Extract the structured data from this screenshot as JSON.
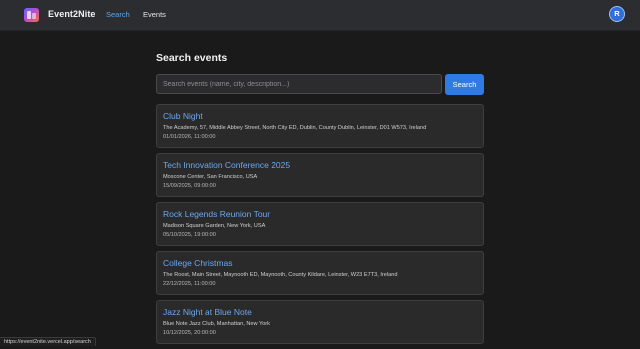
{
  "nav": {
    "brand": "Event2Nite",
    "links": [
      {
        "label": "Search",
        "active": true
      },
      {
        "label": "Events",
        "active": false
      }
    ],
    "avatar_initial": "R",
    "logo_icon": "app-logo-icon"
  },
  "main": {
    "title": "Search events",
    "search": {
      "placeholder": "Search events (name, city, description...)",
      "value": "",
      "button_label": "Search"
    },
    "events": [
      {
        "title": "Club Night",
        "location": "The Academy, 57, Middle Abbey Street, North City ED, Dublin, County Dublin, Leinster, D01 W573, Ireland",
        "datetime": "01/01/2026, 11:00:00"
      },
      {
        "title": "Tech Innovation Conference 2025",
        "location": "Moscone Center, San Francisco, USA",
        "datetime": "15/09/2025, 09:00:00"
      },
      {
        "title": "Rock Legends Reunion Tour",
        "location": "Madison Square Garden, New York, USA",
        "datetime": "05/10/2025, 19:00:00"
      },
      {
        "title": "College Christmas",
        "location": "The Roost, Main Street, Maynooth ED, Maynooth, County Kildare, Leinster, W23 E7T3, Ireland",
        "datetime": "22/12/2025, 11:00:00"
      },
      {
        "title": "Jazz Night at Blue Note",
        "location": "Blue Note Jazz Club, Manhattan, New York",
        "datetime": "10/12/2025, 20:00:00"
      }
    ]
  },
  "status_bar": {
    "url": "https://event2nite.vercel.app/search"
  },
  "colors": {
    "background": "#1a1a1a",
    "topbar": "#2b2d31",
    "accent": "#2f7ae5",
    "link": "#6aa8f0",
    "active_nav": "#5fa8e8"
  }
}
